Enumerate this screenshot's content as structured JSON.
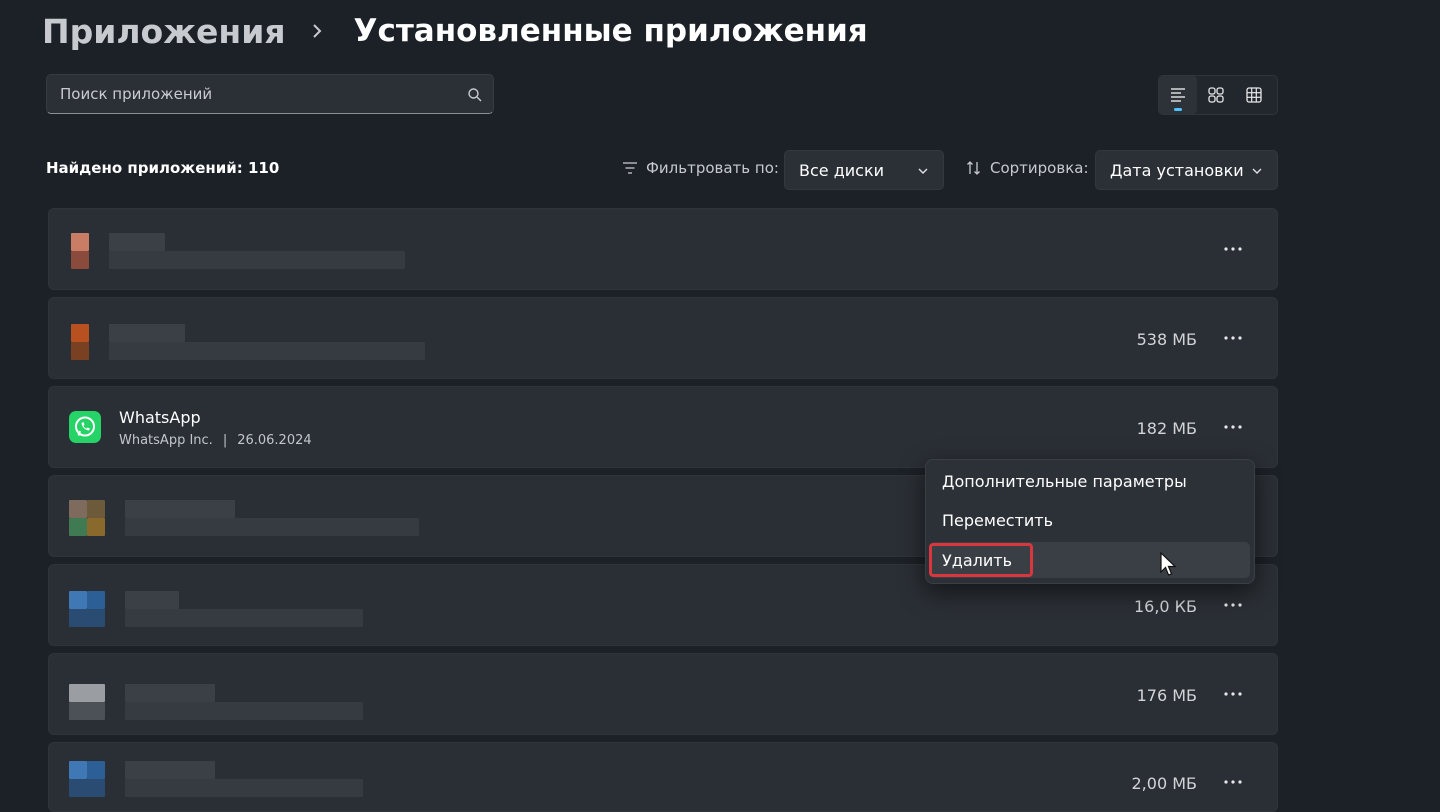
{
  "breadcrumb": {
    "parent": "Приложения",
    "current": "Установленные приложения"
  },
  "search": {
    "placeholder": "Поиск приложений",
    "value": ""
  },
  "view_modes": [
    "list-view-icon",
    "tiles-view-icon",
    "grid-view-icon"
  ],
  "summary": {
    "found_label": "Найдено приложений: 110"
  },
  "filter": {
    "label": "Фильтровать по:",
    "value": "Все диски"
  },
  "sort": {
    "label": "Сортировка:",
    "value": "Дата установки"
  },
  "apps": [
    {
      "name": "",
      "publisher": "",
      "date": "",
      "size": ""
    },
    {
      "name": "",
      "publisher": "",
      "date": "",
      "size": "538 МБ"
    },
    {
      "name": "WhatsApp",
      "publisher": "WhatsApp Inc.",
      "separator": "|",
      "date": "26.06.2024",
      "size": "182 МБ"
    },
    {
      "name": "",
      "publisher": "",
      "date": "",
      "size": ""
    },
    {
      "name": "",
      "publisher": "",
      "date": "",
      "size": "16,0 КБ"
    },
    {
      "name": "",
      "publisher": "",
      "date": "",
      "size": "176 МБ"
    },
    {
      "name": "",
      "publisher": "",
      "date": "",
      "size": "2,00 МБ"
    }
  ],
  "context_menu": {
    "items": [
      {
        "label": "Дополнительные параметры"
      },
      {
        "label": "Переместить"
      },
      {
        "label": "Удалить"
      }
    ]
  },
  "colors": {
    "background": "#1c2127",
    "card": "#2a2f35",
    "accent": "#4cc2ff",
    "highlight_border": "#d9363e",
    "whatsapp_green": "#25d366"
  }
}
